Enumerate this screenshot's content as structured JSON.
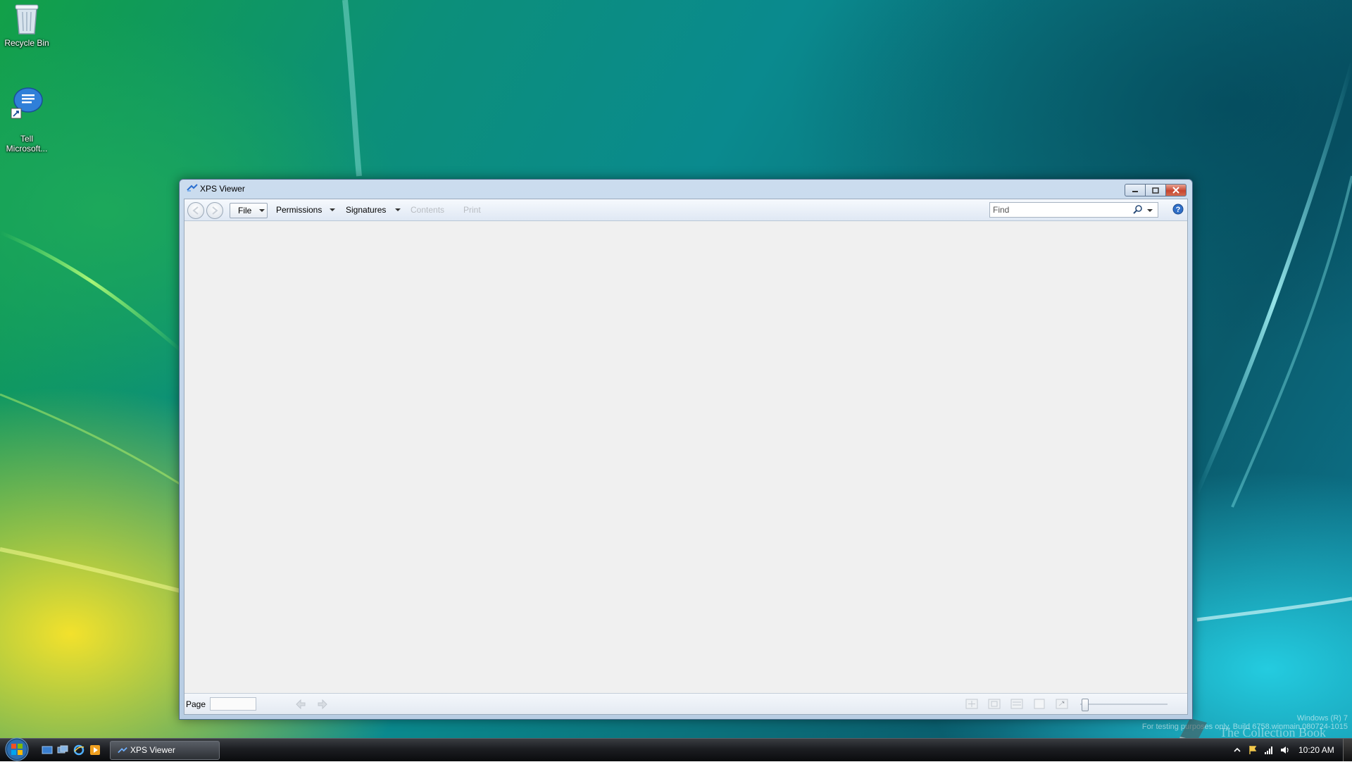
{
  "desktop": {
    "icons": [
      {
        "label": "Recycle Bin"
      },
      {
        "label": "Tell\nMicrosoft..."
      }
    ],
    "watermark": {
      "line1": "Windows (R) 7",
      "line2": "For testing purposes only. Build 6758.winmain.080724-1015",
      "logo_text": "The Collection Book"
    }
  },
  "window": {
    "title": "XPS Viewer",
    "toolbar": {
      "menus": [
        {
          "label": "File",
          "enabled": true
        },
        {
          "label": "Permissions",
          "enabled": true
        },
        {
          "label": "Signatures",
          "enabled": true
        },
        {
          "label": "Contents",
          "enabled": false
        },
        {
          "label": "Print",
          "enabled": false
        }
      ],
      "find_placeholder": "Find"
    },
    "statusbar": {
      "page_label": "Page",
      "page_value": ""
    }
  },
  "taskbar": {
    "task_button_label": "XPS Viewer",
    "clock": "10:20 AM"
  },
  "colors": {
    "close_button": "#c8452f",
    "taskbar": "#1c1e22",
    "window_frame": "#b8cde3"
  }
}
